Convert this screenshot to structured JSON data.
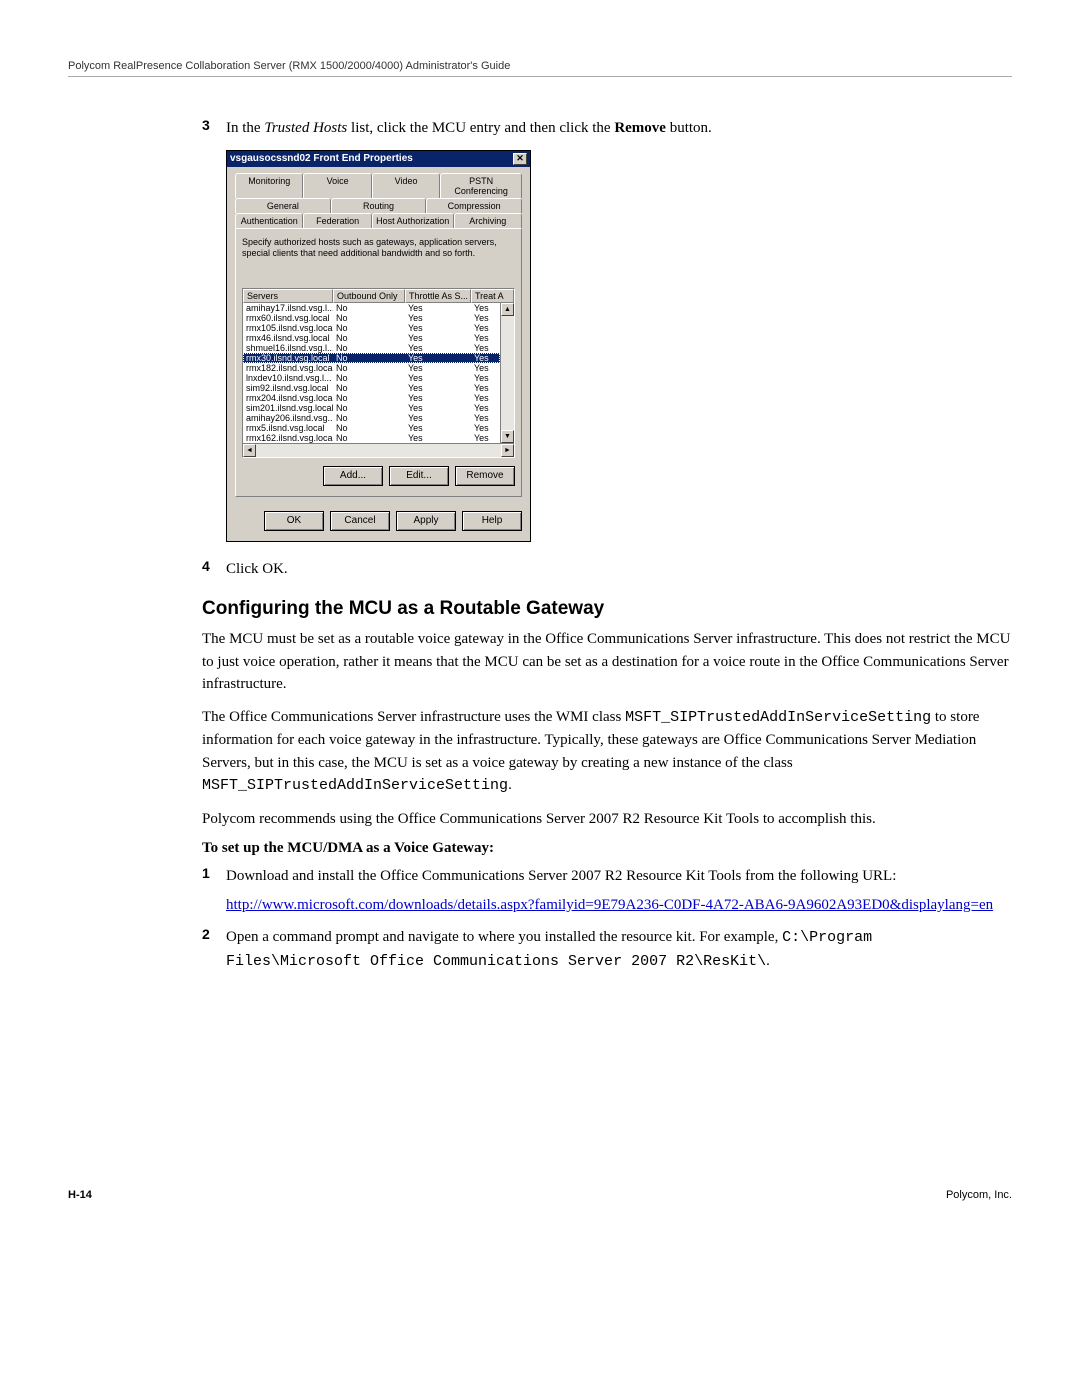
{
  "header": "Polycom RealPresence Collaboration Server (RMX 1500/2000/4000) Administrator's Guide",
  "step3": {
    "num": "3",
    "text_pre": "In the ",
    "text_italic": "Trusted Hosts",
    "text_mid": " list, click the MCU entry and then click the ",
    "text_bold": "Remove",
    "text_post": " button."
  },
  "dialog": {
    "title": "vsgausocssnd02 Front End Properties",
    "tabs_row1": [
      "Monitoring",
      "Voice",
      "Video",
      "PSTN Conferencing"
    ],
    "tabs_row2": [
      "General",
      "Routing",
      "Compression"
    ],
    "tabs_row3": [
      "Authentication",
      "Federation",
      "Host Authorization",
      "Archiving"
    ],
    "desc": "Specify authorized hosts such as gateways, application servers, special clients that need additional bandwidth and so forth.",
    "table": {
      "headers": [
        "Servers",
        "Outbound Only",
        "Throttle As S...",
        "Treat A"
      ],
      "rows": [
        {
          "s": "amihay17.ilsnd.vsg.l...",
          "o": "No",
          "t": "Yes",
          "r": "Yes"
        },
        {
          "s": "rmx60.ilsnd.vsg.local",
          "o": "No",
          "t": "Yes",
          "r": "Yes"
        },
        {
          "s": "rmx105.ilsnd.vsg.local",
          "o": "No",
          "t": "Yes",
          "r": "Yes"
        },
        {
          "s": "rmx46.ilsnd.vsg.local",
          "o": "No",
          "t": "Yes",
          "r": "Yes"
        },
        {
          "s": "shmuel16.ilsnd.vsg.l...",
          "o": "No",
          "t": "Yes",
          "r": "Yes"
        },
        {
          "s": "rmx30.ilsnd.vsg.local",
          "o": "No",
          "t": "Yes",
          "r": "Yes",
          "selected": true
        },
        {
          "s": "rmx182.ilsnd.vsg.local",
          "o": "No",
          "t": "Yes",
          "r": "Yes"
        },
        {
          "s": "lnxdev10.ilsnd.vsg.l...",
          "o": "No",
          "t": "Yes",
          "r": "Yes"
        },
        {
          "s": "sim92.ilsnd.vsg.local",
          "o": "No",
          "t": "Yes",
          "r": "Yes"
        },
        {
          "s": "rmx204.ilsnd.vsg.local",
          "o": "No",
          "t": "Yes",
          "r": "Yes"
        },
        {
          "s": "sim201.ilsnd.vsg.local",
          "o": "No",
          "t": "Yes",
          "r": "Yes"
        },
        {
          "s": "amihay206.ilsnd.vsg...",
          "o": "No",
          "t": "Yes",
          "r": "Yes"
        },
        {
          "s": "rmx5.ilsnd.vsg.local",
          "o": "No",
          "t": "Yes",
          "r": "Yes"
        },
        {
          "s": "rmx162.ilsnd.vsg.local",
          "o": "No",
          "t": "Yes",
          "r": "Yes"
        }
      ]
    },
    "btns_panel": [
      "Add...",
      "Edit...",
      "Remove"
    ],
    "btns_dialog": [
      "OK",
      "Cancel",
      "Apply",
      "Help"
    ]
  },
  "step4": {
    "num": "4",
    "text": "Click OK."
  },
  "h2": "Configuring the MCU as a Routable Gateway",
  "p1": "The MCU must be set as a routable voice gateway in the Office Communications Server infrastructure. This does not restrict the MCU to just voice operation, rather it means that the MCU can be set as a destination for a voice route in the Office Communications Server infrastructure.",
  "p2a": "The Office Communications Server infrastructure uses the WMI class ",
  "p2_code1": "MSFT_SIPTrustedAddInServiceSetting",
  "p2b": " to store information for each voice gateway in the infrastructure. Typically, these gateways are Office Communications Server Mediation Servers, but in this case, the MCU is set as a voice gateway by creating a new instance of the class ",
  "p2_code2": "MSFT_SIPTrustedAddInServiceSetting",
  "p2c": ".",
  "p3": "Polycom recommends using the Office Communications Server 2007 R2 Resource Kit Tools to accomplish this.",
  "p4": "To set up the MCU/DMA as a Voice Gateway:",
  "nstep1": {
    "num": "1",
    "text": "Download and install the Office Communications Server 2007 R2 Resource Kit Tools from the following URL:",
    "url": "http://www.microsoft.com/downloads/details.aspx?familyid=9E79A236-C0DF-4A72-ABA6-9A9602A93ED0&displaylang=en"
  },
  "nstep2": {
    "num": "2",
    "text_a": "Open a command prompt and navigate to where you installed the resource kit. For example, ",
    "code": "C:\\Program Files\\Microsoft Office Communications Server 2007 R2\\ResKit\\",
    "text_b": "."
  },
  "footer": {
    "page": "H-14",
    "right": "Polycom, Inc."
  }
}
